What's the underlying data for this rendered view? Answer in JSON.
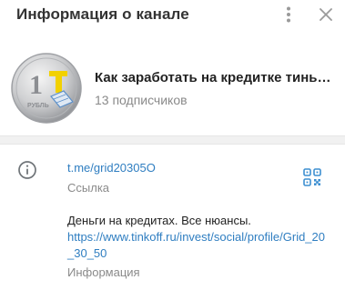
{
  "header": {
    "title": "Информация о канале"
  },
  "channel": {
    "name": "Как заработать на кредитке тинькофф",
    "subscribers": "13 подписчиков",
    "avatar_text": "1",
    "avatar_subtext": "РУБЛЬ"
  },
  "link_section": {
    "link": "t.me/grid20305O",
    "caption": "Ссылка"
  },
  "description_section": {
    "text": "Деньги на кредитах. Все нюансы.",
    "url": "https://www.tinkoff.ru/invest/social/profile/Grid_20_30_50",
    "caption": "Информация"
  },
  "colors": {
    "accent": "#2f7ec1",
    "muted": "#8a8a8a",
    "coin_yellow": "#f2d100"
  },
  "icons": {
    "more": "more-vertical-icon",
    "close": "close-icon",
    "info": "info-icon",
    "qr": "qr-code-icon"
  }
}
